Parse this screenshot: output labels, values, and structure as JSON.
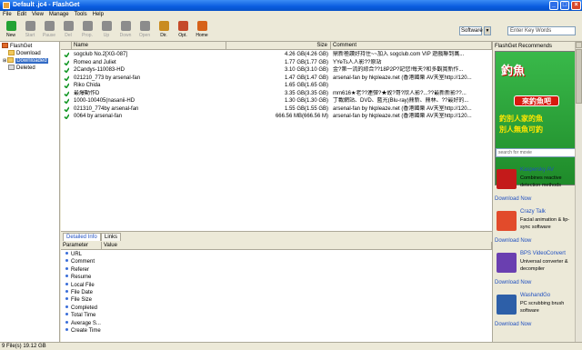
{
  "window": {
    "title": "Default .jc4 - FlashGet"
  },
  "menu": [
    "File",
    "Edit",
    "View",
    "Manage",
    "Tools",
    "Help"
  ],
  "toolbar": {
    "buttons": [
      {
        "label": "New",
        "color": "#22a233",
        "enabled": true
      },
      {
        "label": "Start",
        "color": "#8c8c8c",
        "enabled": false
      },
      {
        "label": "Pause",
        "color": "#8c8c8c",
        "enabled": false
      },
      {
        "label": "Del",
        "color": "#8c8c8c",
        "enabled": false
      },
      {
        "label": "Prop.",
        "color": "#8c8c8c",
        "enabled": false
      },
      {
        "label": "Up",
        "color": "#8c8c8c",
        "enabled": false
      },
      {
        "label": "Down",
        "color": "#8c8c8c",
        "enabled": false
      },
      {
        "label": "Open",
        "color": "#8c8c8c",
        "enabled": false
      },
      {
        "label": "Dir.",
        "color": "#c98b1f",
        "enabled": true
      },
      {
        "label": "Opt.",
        "color": "#c54a2a",
        "enabled": true
      },
      {
        "label": "Home",
        "color": "#d6621a",
        "enabled": true
      }
    ],
    "search_category": "Software",
    "search_placeholder": "Enter Key Words"
  },
  "tree": {
    "root": "FlashGet",
    "items": [
      "Download",
      "Downloaded",
      "Deleted"
    ],
    "selected": "Downloaded"
  },
  "table": {
    "headers": [
      "",
      "Name",
      "Size",
      "Comment"
    ],
    "rows": [
      {
        "name": "sogclub No.2[XG-087]",
        "size": "4.26 GB(4.26 GB)",
        "comment": "鼎新極讚好持住~~加入 sogclub.com VIP 遊戲聯到萬..."
      },
      {
        "name": "Romeo and Juliet",
        "size": "1.77 GB(1.77 GB)",
        "comment": "YYeTs人人影??原站"
      },
      {
        "name": "2Candys-110083-HD",
        "size": "3.10 GB(3.10 GB)",
        "comment": "金?第一流的綜合??18P2P?記您!每天?和多觀賞新作..."
      },
      {
        "name": "021210_773 by arsenal-fan",
        "size": "1.47 GB(1.47 GB)",
        "comment": "arsenal-fan by hkpleaze.net (香港國樂 AV天室http://120..."
      },
      {
        "name": "Riko Chida",
        "size": "1.65 GB(1.65 GB)",
        "comment": ""
      },
      {
        "name": "最爆動作D",
        "size": "3.35 GB(3.35 GB)",
        "comment": "mm616★老??連彈?★故?哥?欣人影?...??最新新影??..."
      },
      {
        "name": "1000-100405(nasanii-HD",
        "size": "1.30 GB(1.30 GB)",
        "comment": "丁載網站、DVD、藍光(Blu-ray)鼎新、鼎林、??最好的..."
      },
      {
        "name": "021310_774by arsenal-fan",
        "size": "1.55 GB(1.55 GB)",
        "comment": "arsenal-fan by hkpleaze.net (香港國樂 AV天室http://120..."
      },
      {
        "name": "0064 by arsenal-fan",
        "size": "666.56 MB(666.56 M)",
        "comment": "arsenal-fan by hkpleaze.net (香港國樂 AV天室http://120..."
      }
    ]
  },
  "bottom": {
    "tabs": [
      "Detailed Info",
      "Links"
    ],
    "active": "Detailed Info",
    "headers": [
      "Parameter",
      "Value"
    ],
    "params": [
      "URL",
      "Comment",
      "Referer",
      "Resume",
      "Local File",
      "File Date",
      "File Size",
      "Completed",
      "Total Time",
      "Average S...",
      "Create Time"
    ]
  },
  "right": {
    "header": "FlashGet Recommends",
    "search_placeholder": "search for movie",
    "ad": {
      "line1": "釣魚",
      "button": "來釣魚吧",
      "line2": "釣別人家的魚",
      "line3": "別人無魚可釣"
    },
    "items": [
      {
        "title": "Kaspersky AV",
        "desc": "Combines reactive detection methods",
        "color": "#c41a1a",
        "download": "Download Now"
      },
      {
        "title": "Crazy Talk",
        "desc": "Facial animation & lip-sync software",
        "color": "#e24b2b",
        "download": "Download Now"
      },
      {
        "title": "BPS VideoConvert",
        "desc": "Universal converter & decompiler",
        "color": "#6a3fb0",
        "download": "Download Now"
      },
      {
        "title": "WashandGo",
        "desc": "PC scrubbing brush software",
        "color": "#2d5fa8",
        "download": "Download Now"
      }
    ]
  },
  "status": {
    "text": "9 File(s)   19.12 GB"
  }
}
